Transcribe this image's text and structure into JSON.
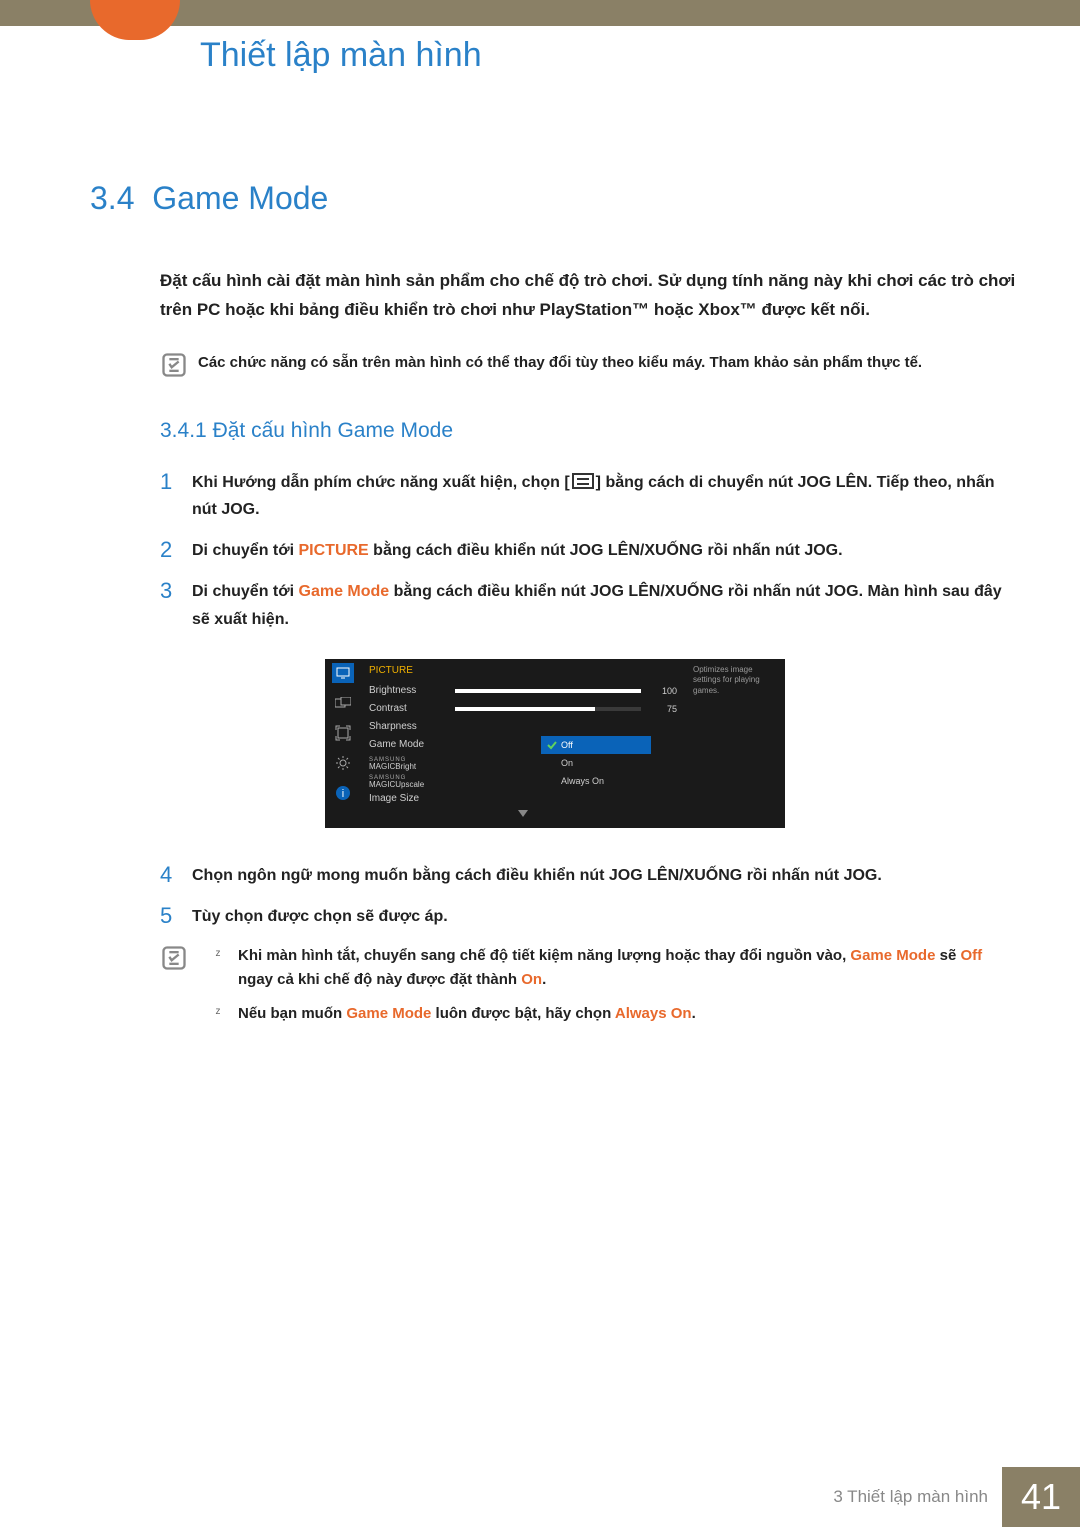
{
  "header": {
    "chapter_title": "Thiết lập màn hình"
  },
  "section": {
    "number": "3.4",
    "title": "Game Mode",
    "intro": "Đặt cấu hình cài đặt màn hình sản phẩm cho chế độ trò chơi. Sử dụng tính năng này khi chơi các trò chơi trên PC hoặc khi bảng điều khiển trò chơi như PlayStation™ hoặc Xbox™ được kết nối.",
    "note": "Các chức năng có sẵn trên màn hình có thể thay đổi tùy theo kiểu máy. Tham khảo sản phẩm thực tế."
  },
  "subsection": {
    "number": "3.4.1",
    "title": "Đặt cấu hình Game Mode"
  },
  "steps": {
    "s1a": "Khi Hướng dẫn phím chức năng xuất hiện, chọn [",
    "s1b": "] bằng cách di chuyển nút JOG LÊN. Tiếp theo, nhấn nút JOG.",
    "s2a": "Di chuyển tới ",
    "s2hl": "PICTURE",
    "s2b": " bằng cách điều khiển nút JOG LÊN/XUỐNG rồi nhấn nút JOG.",
    "s3a": "Di chuyển tới ",
    "s3hl": "Game Mode",
    "s3b": " bằng cách điều khiển nút JOG LÊN/XUỐNG rồi nhấn nút JOG. Màn hình sau đây sẽ xuất hiện.",
    "s4": "Chọn ngôn ngữ mong muốn bằng cách điều khiển nút JOG LÊN/XUỐNG rồi nhấn nút JOG.",
    "s5": "Tùy chọn được chọn sẽ được áp."
  },
  "osd": {
    "title": "PICTURE",
    "rows": [
      {
        "label": "Brightness",
        "value": "100",
        "fill": 100
      },
      {
        "label": "Contrast",
        "value": "75",
        "fill": 75
      },
      {
        "label": "Sharpness"
      },
      {
        "label": "Game Mode"
      }
    ],
    "options": [
      {
        "label": "Off",
        "selected": true
      },
      {
        "label": "On",
        "selected": false
      },
      {
        "label": "Always On",
        "selected": false
      }
    ],
    "magic_items": [
      "Bright",
      "Upscale"
    ],
    "last_row": "Image Size",
    "tip": "Optimizes image settings for playing games."
  },
  "bullets": {
    "b1a": "Khi màn hình tắt, chuyển sang chế độ tiết kiệm năng lượng hoặc thay đổi nguồn vào, ",
    "b1hl1": "Game Mode",
    "b1b": " sẽ ",
    "b1hl2": "Off",
    "b1c": " ngay cả khi chế độ này được đặt thành ",
    "b1hl3": "On",
    "b1d": ".",
    "b2a": "Nếu bạn muốn ",
    "b2hl1": "Game Mode",
    "b2b": " luôn được bật, hãy chọn ",
    "b2hl2": "Always On",
    "b2c": "."
  },
  "footer": {
    "chapter": "3 Thiết lập màn hình",
    "page": "41"
  }
}
